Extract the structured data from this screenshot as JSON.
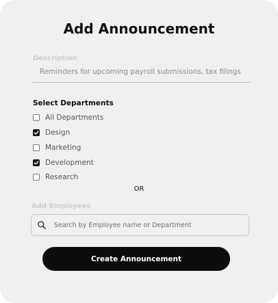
{
  "dialog": {
    "title": "Add Announcement",
    "description_label": "Description",
    "description_value": "Reminders for upcoming payroll submissions, tax filings",
    "departments_title": "Select Departments",
    "departments": [
      {
        "label": "All Departments",
        "checked": false
      },
      {
        "label": "Design",
        "checked": true
      },
      {
        "label": "Marketing",
        "checked": false
      },
      {
        "label": "Development",
        "checked": true
      },
      {
        "label": "Research",
        "checked": false
      }
    ],
    "or_text": "OR",
    "employees_label": "Add Employees",
    "search_placeholder": "Search by Employee name or Department",
    "create_button": "Create Announcement"
  },
  "icons": {
    "search": "search-icon",
    "checkbox_checked": "checkmark-icon"
  },
  "colors": {
    "card_background": "#f0f0f0",
    "button_background": "#0d0d0d",
    "button_text": "#ffffff",
    "faint_label": "#cfcfcf"
  }
}
